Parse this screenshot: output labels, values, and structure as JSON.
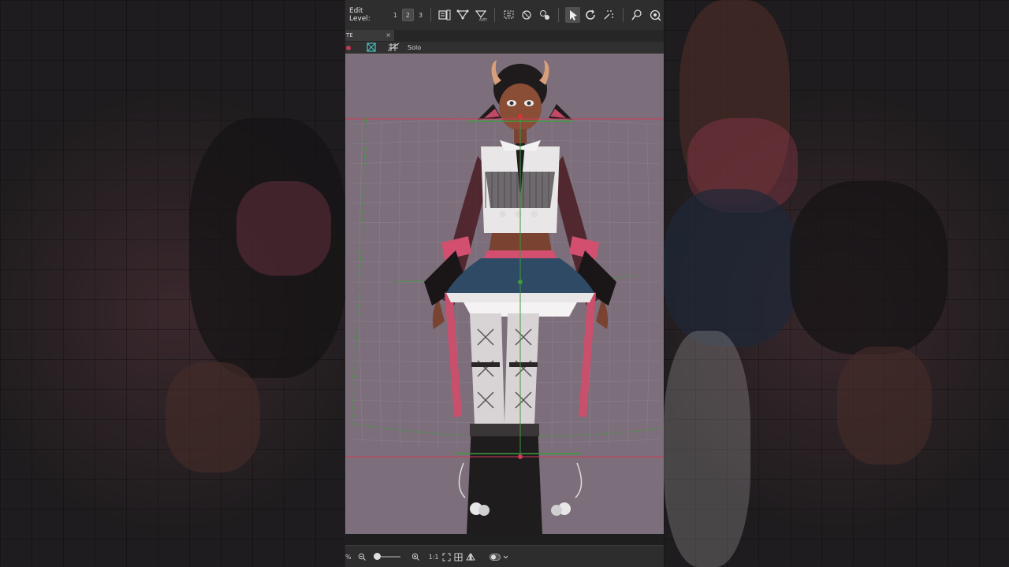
{
  "toolbar": {
    "edit_level_label": "Edit Level:",
    "levels": [
      "1",
      "2",
      "3"
    ],
    "active_level": "2",
    "icons": [
      "mesh-edit-icon",
      "auto-mesh-icon",
      "auto-mesh-generate-icon",
      "lasso-select-icon",
      "deform-path-icon",
      "deform-brush-icon",
      "arrow-select-icon",
      "rotation-icon",
      "glue-icon",
      "pin-icon",
      "pin-settings-icon"
    ]
  },
  "tab": {
    "label": "TE",
    "close": "×"
  },
  "subbar": {
    "solo_label": "Solo"
  },
  "bottombar": {
    "percent_label": "%",
    "zoom_ratio": "1:1",
    "icons": [
      "zoom-out-icon",
      "zoom-slider",
      "zoom-in-icon",
      "fit-icon",
      "grid-icon",
      "flip-icon",
      "toggle-icon",
      "chevron-down-icon"
    ]
  },
  "colors": {
    "canvas_bg": "#7c6e7a",
    "guide_line": "#d03a5a",
    "deform_grid": "#3e9a3e"
  }
}
